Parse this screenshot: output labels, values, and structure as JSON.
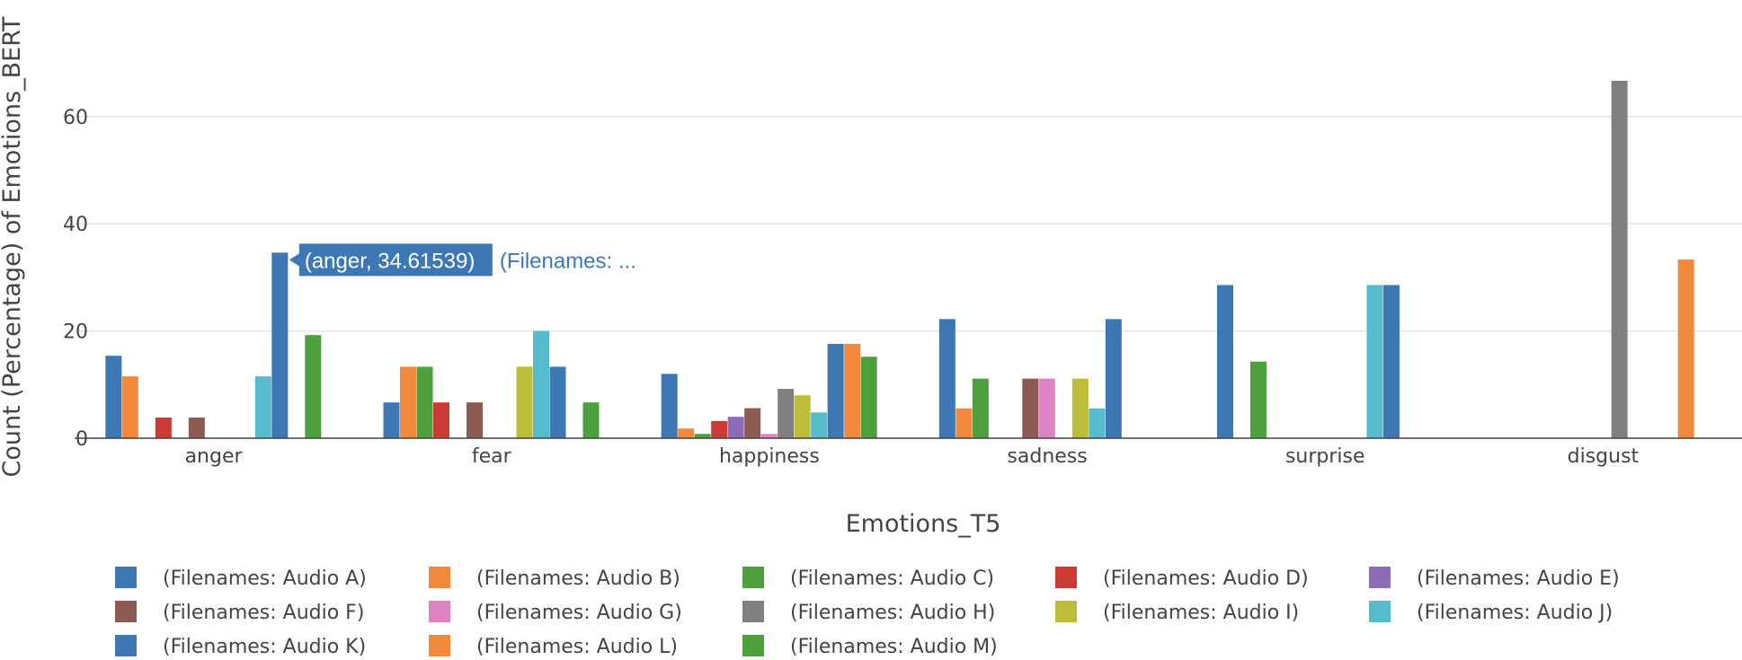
{
  "chart_data": {
    "type": "bar",
    "xlabel": "Emotions_T5",
    "ylabel": "Count (Percentage) of Emotions_BERT",
    "ylim": [
      0,
      70
    ],
    "yticks": [
      0,
      20,
      40,
      60
    ],
    "grid": true,
    "legend_position": "bottom",
    "categories": [
      "anger",
      "fear",
      "happiness",
      "sadness",
      "surprise",
      "disgust"
    ],
    "series": [
      {
        "name": "(Filenames: Audio A)",
        "color": "#3d78b4",
        "values": [
          15.38,
          6.67,
          12.0,
          22.22,
          28.57,
          0
        ]
      },
      {
        "name": "(Filenames: Audio B)",
        "color": "#f28a3d",
        "values": [
          11.54,
          13.33,
          1.8,
          5.56,
          0,
          0
        ]
      },
      {
        "name": "(Filenames: Audio C)",
        "color": "#4e9f3d",
        "values": [
          0,
          13.33,
          0.8,
          11.11,
          14.29,
          0
        ]
      },
      {
        "name": "(Filenames: Audio D)",
        "color": "#cc3b33",
        "values": [
          3.85,
          6.67,
          3.2,
          0,
          0,
          0
        ]
      },
      {
        "name": "(Filenames: Audio E)",
        "color": "#8e6cba",
        "values": [
          0,
          0,
          4.0,
          0,
          0,
          0
        ]
      },
      {
        "name": "(Filenames: Audio F)",
        "color": "#8c5a50",
        "values": [
          3.85,
          6.67,
          5.6,
          11.11,
          0,
          0
        ]
      },
      {
        "name": "(Filenames: Audio G)",
        "color": "#dc84c4",
        "values": [
          0,
          0,
          0.8,
          11.11,
          0,
          0
        ]
      },
      {
        "name": "(Filenames: Audio H)",
        "color": "#808080",
        "values": [
          0,
          0,
          9.2,
          0,
          0,
          66.67
        ]
      },
      {
        "name": "(Filenames: Audio I)",
        "color": "#bdbd3a",
        "values": [
          0,
          13.33,
          8.0,
          11.11,
          0,
          0
        ]
      },
      {
        "name": "(Filenames: Audio J)",
        "color": "#56bccd",
        "values": [
          11.54,
          20.0,
          4.8,
          5.56,
          28.57,
          0
        ]
      },
      {
        "name": "(Filenames: Audio K)",
        "color": "#3d78b4",
        "values": [
          34.61539,
          13.33,
          17.6,
          22.22,
          28.57,
          0
        ]
      },
      {
        "name": "(Filenames: Audio L)",
        "color": "#f28a3d",
        "values": [
          0,
          0,
          17.6,
          0,
          0,
          33.33
        ]
      },
      {
        "name": "(Filenames: Audio M)",
        "color": "#4e9f3d",
        "values": [
          19.23,
          6.67,
          15.2,
          0,
          0,
          0
        ]
      }
    ]
  },
  "tooltip": {
    "label": "(anger, 34.61539)",
    "series_text": "(Filenames: ...",
    "color": "#3d78b4"
  }
}
